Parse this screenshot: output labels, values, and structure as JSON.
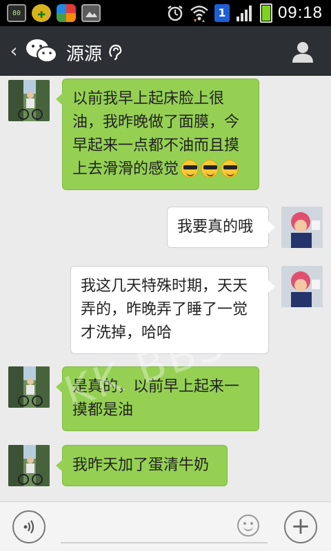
{
  "status_bar": {
    "time": "09:18",
    "sim_slot": "1",
    "app_icons": [
      "battery-app-icon",
      "plus-app-icon",
      "flower-app-icon",
      "gallery-icon"
    ],
    "battery_label": "80"
  },
  "header": {
    "back_glyph": "‹",
    "title": "源源",
    "earpiece_glyph": "ᪿ"
  },
  "messages": [
    {
      "side": "left",
      "text": "以前我早上起床脸上很油，我昨晚做了面膜，今早起来一点都不油而且摸上去滑滑的感觉",
      "emoji_count": 3
    },
    {
      "side": "right",
      "text": "我要真的哦"
    },
    {
      "side": "right",
      "text": "我这几天特殊时期，天天弄的，昨晚弄了睡了一觉才洗掉，哈哈"
    },
    {
      "side": "left",
      "text": "是真的，以前早上起来一摸都是油"
    },
    {
      "side": "left",
      "text": "我昨天加了蛋清牛奶"
    }
  ],
  "watermark": "KK BBS",
  "input_bar": {
    "placeholder": "",
    "voice_glyph": "🔊",
    "plus_glyph": "+"
  },
  "colors": {
    "header_bg": "#2c2f33",
    "green_bubble": "#95d053",
    "white_bubble": "#ffffff",
    "chat_bg": "#ebebeb"
  }
}
